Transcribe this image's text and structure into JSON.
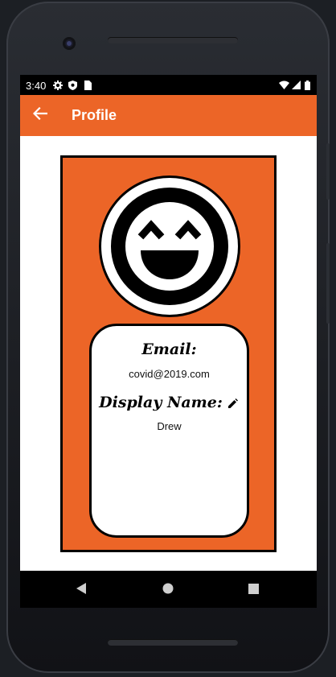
{
  "status_bar": {
    "time": "3:40",
    "icons": [
      "gear-icon",
      "shield-icon",
      "sim-card-icon",
      "wifi-icon",
      "cell-signal-icon",
      "battery-icon"
    ]
  },
  "app_bar": {
    "title": "Profile",
    "back_icon": "arrow-back-icon",
    "color": "#ec6527"
  },
  "profile": {
    "avatar_icon": "smiley-face-icon",
    "email_label": "Email:",
    "email_value": "covid@2019.com",
    "display_name_label": "Display Name:",
    "display_name_value": "Drew",
    "edit_icon": "pencil-icon"
  },
  "nav_bar": {
    "buttons": [
      "back-triangle-icon",
      "home-circle-icon",
      "recents-square-icon"
    ]
  },
  "colors": {
    "accent": "#ec6527",
    "panel": "#ffffff",
    "outline": "#000000"
  }
}
